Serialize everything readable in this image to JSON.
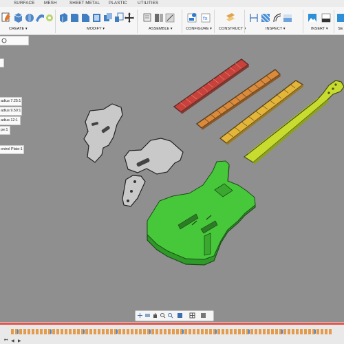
{
  "tabs": [
    "SURFACE",
    "MESH",
    "SHEET METAL",
    "PLASTIC",
    "UTILITIES"
  ],
  "toolbar": {
    "groups": [
      "CREATE ▾",
      "MODIFY ▾",
      "ASSEMBLE ▾",
      "CONFIGURE ▾",
      "CONSTRUCT ▾",
      "INSPECT ▾",
      "INSERT ▾",
      "SE"
    ]
  },
  "browser": {
    "items": [
      "adius 7.25:1",
      "adius 9.50:1",
      "adius 12:1",
      "pe:1",
      "ontrol Plate:1"
    ]
  },
  "colors": {
    "body_green": "#46c83a",
    "fretboard_red": "#c9413b",
    "fretboard_orange": "#d98a3a",
    "fretboard_yellow": "#e3b63a",
    "neck_yellowgreen": "#c7dc2f",
    "pickguard": "#c9c9c9",
    "viewport_bg": "#8f8f8f"
  },
  "icons": {
    "nav": [
      "orbit-icon",
      "pan-icon",
      "hand-icon",
      "zoom-icon",
      "zoom-window-icon",
      "display-icon",
      "grid-icon",
      "view-icon"
    ]
  }
}
